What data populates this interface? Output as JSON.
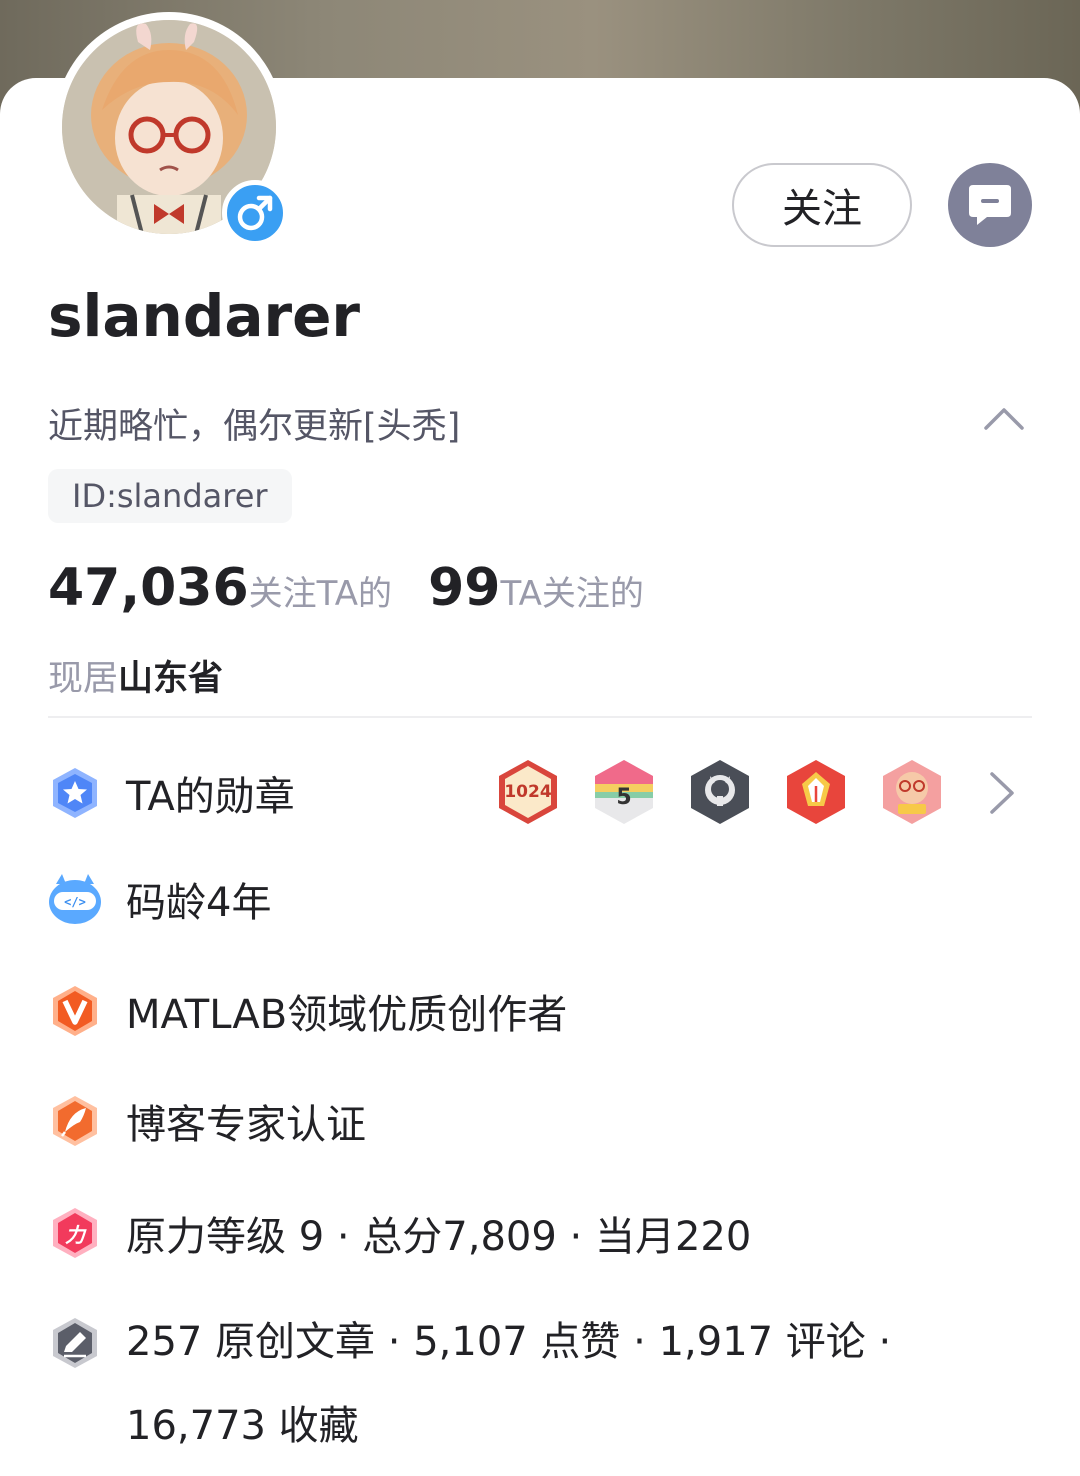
{
  "profile": {
    "follow_label": "关注",
    "username": "slandarer",
    "bio": "近期略忙，偶尔更新[头秃]",
    "id_text": "ID:slandarer",
    "followers_count": "47,036",
    "followers_label": "关注TA的",
    "following_count": "99",
    "following_label": "TA关注的",
    "location_prefix": "现居",
    "location_value": "山东省"
  },
  "info_rows": {
    "medals": "TA的勋章",
    "code_age": "码龄4年",
    "matlab": "MATLAB领域优质创作者",
    "expert": "博客专家认证",
    "level": "原力等级 9 · 总分7,809 · 当月220",
    "articles": "257 原创文章 · 5,107 点赞 · 1,917 评论 · 16,773 收藏"
  },
  "badge_texts": {
    "b1024": "1024",
    "b5": "5"
  },
  "icons": [
    "gender-male-icon",
    "message-icon",
    "chevron-up-icon",
    "medal-star-icon",
    "code-age-icon",
    "v-creator-icon",
    "feather-expert-icon",
    "force-level-icon",
    "pen-articles-icon",
    "chevron-right-icon"
  ],
  "colors": {
    "follow_border": "#c9c9ce",
    "message_button": "#7f8199",
    "gender_badge": "#3a9ff3",
    "secondary_text": "#999aaa"
  }
}
